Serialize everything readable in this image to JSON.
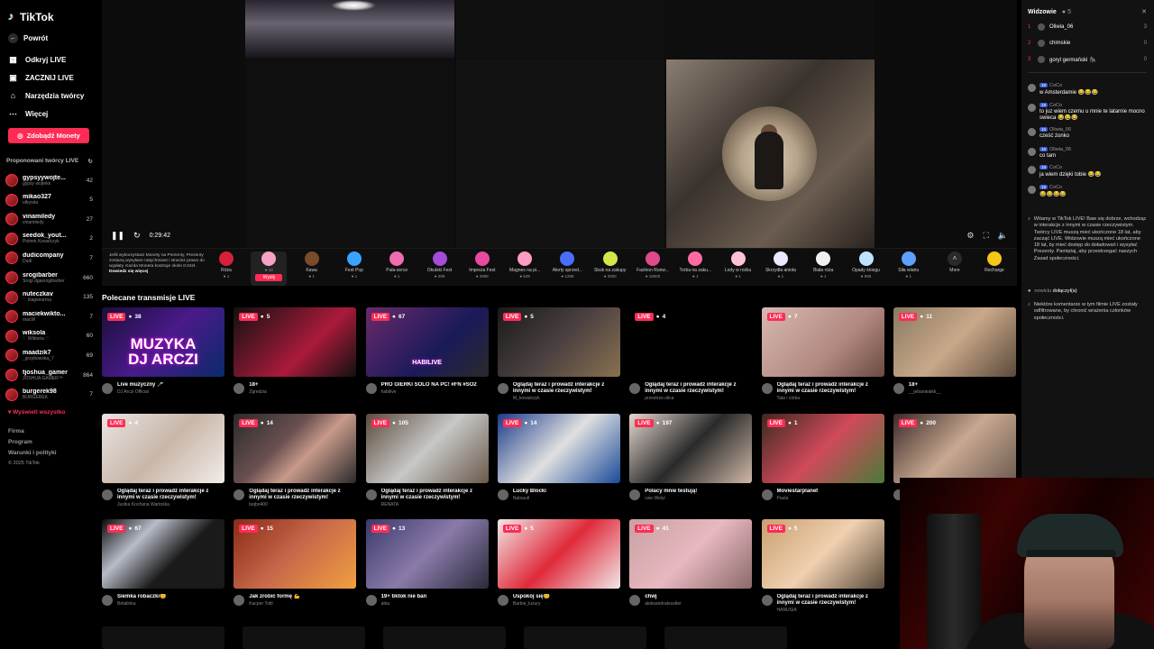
{
  "app": {
    "logo": "TikTok"
  },
  "sidebar": {
    "back": "Powrót",
    "nav": [
      {
        "label": "Odkryj LIVE",
        "icon": "tv-icon"
      },
      {
        "label": "ZACZNIJ LIVE",
        "icon": "live-icon"
      },
      {
        "label": "Narzędzia twórcy",
        "icon": "lightbulb-icon"
      },
      {
        "label": "Więcej",
        "icon": "more-icon"
      }
    ],
    "coins_button": "Zdobądź Monety",
    "suggested_title": "Proponowani twórcy LIVE",
    "creators": [
      {
        "name": "gypsyywojte...",
        "handle": "gypsy wojtekk",
        "count": "42"
      },
      {
        "name": "mikao327",
        "handle": "olkyoda",
        "count": "5"
      },
      {
        "name": "vinamiledy",
        "handle": "vinamiledy",
        "count": "27"
      },
      {
        "name": "seedok_yout...",
        "handle": "Piotrek Kowalczyk",
        "count": "2"
      },
      {
        "name": "dudicompany",
        "handle": "Dudi",
        "count": "7"
      },
      {
        "name": "srogibarber",
        "handle": "Srogi dgasrogibarber",
        "count": "660"
      },
      {
        "name": "nuteczkav",
        "handle": "♡ klagveurrna",
        "count": "135"
      },
      {
        "name": "maciekwikto...",
        "handle": "macW",
        "count": "7"
      },
      {
        "name": "wiksola",
        "handle": "♡ Wiktoria ♡",
        "count": "60"
      },
      {
        "name": "maadzik7",
        "handle": "_grzybowska_7",
        "count": "69"
      },
      {
        "name": "tjoshua_gamer",
        "handle": "JOSHUA GAMER™",
        "count": "864"
      },
      {
        "name": "burgerek98",
        "handle": "BURGEREK",
        "count": "7"
      }
    ],
    "show_all": "Wyświetl wszystko",
    "footer": [
      "Firma",
      "Program",
      "Warunki i polityki"
    ],
    "copyright": "© 2025 TikTok"
  },
  "player": {
    "time": "0:29:42"
  },
  "gifts": {
    "info": "Jeśli wykorzystasz Monety na Prezenty, Prezenty zostaną wysyłane natychmiast i stracisz prawo do wypłaty. Każda Moneta kosztuje około 0.04zł.",
    "info_link": "Dowiedz się więcej",
    "send_label": "Wyślij",
    "items": [
      {
        "name": "Róża",
        "price": "1",
        "color": "#d6203a"
      },
      {
        "name": "",
        "price": "10",
        "color": "#f7a1c4",
        "selected": true
      },
      {
        "name": "Kawa",
        "price": "1",
        "color": "#7b4a2a"
      },
      {
        "name": "Fest Pop",
        "price": "1",
        "color": "#3aa3ff"
      },
      {
        "name": "Puła-serce",
        "price": "1",
        "color": "#f06bb0"
      },
      {
        "name": "Okulski Fest",
        "price": "299",
        "color": "#a44bd9"
      },
      {
        "name": "Impreza Fest",
        "price": "2999",
        "color": "#e84aa0"
      },
      {
        "name": "Magnes na pi...",
        "price": "549",
        "color": "#ff9cc4"
      },
      {
        "name": "Alerty sprzed...",
        "price": "1299",
        "color": "#4a6cff"
      },
      {
        "name": "Skok na zakupy",
        "price": "3000",
        "color": "#d3e54a"
      },
      {
        "name": "Fashion Runw...",
        "price": "19000",
        "color": "#e04a8a"
      },
      {
        "name": "Torba na zaku...",
        "price": "1",
        "color": "#ff6aa5"
      },
      {
        "name": "Lody w rożku",
        "price": "1",
        "color": "#ffc2d4"
      },
      {
        "name": "Skrzydła anioła",
        "price": "1",
        "color": "#e8e8ff"
      },
      {
        "name": "Biała róża",
        "price": "1",
        "color": "#f0f0f0"
      },
      {
        "name": "Opady śniegu",
        "price": "999",
        "color": "#bfe3ff"
      },
      {
        "name": "Siła wiatru",
        "price": "1",
        "color": "#5ea0ff"
      }
    ],
    "more": "More",
    "recharge": "Recharge"
  },
  "recommended": {
    "title": "Polecane transmisje LIVE",
    "live_label": "LIVE",
    "tiles": [
      {
        "viewers": "38",
        "title": "Live muzyczny 🎤",
        "user": "DJ Arczi Official",
        "bg": "linear-gradient(135deg,#1a0f3a,#4a1a8a 50%,#0a2a6a)",
        "overlay": "MUZYKA\nDJ ARCZI"
      },
      {
        "viewers": "5",
        "title": "18+",
        "user": "Zgredzia",
        "bg": "linear-gradient(135deg,#111,#aa1a3a 60%,#111)"
      },
      {
        "viewers": "67",
        "title": "PRO GIERKI SOLO NA PC! #FN #SO2",
        "user": "habilive",
        "bg": "linear-gradient(135deg,#6a2a6a,#1a1a5a 60%,#2a2a2a)",
        "overlay": "HABILIVE"
      },
      {
        "viewers": "5",
        "title": "Oglądaj teraz i prowadź interakcje z innymi w czasie rzeczywistym!",
        "user": "M_kowalczyk",
        "bg": "linear-gradient(135deg,#1a1a1a,#4a4040 50%,#8a7050)"
      },
      {
        "viewers": "4",
        "title": "Oglądaj teraz i prowadź interakcje z innymi w czasie rzeczywistym!",
        "user": "przestrze.olica",
        "bg": "#000"
      },
      {
        "viewers": "7",
        "title": "Oglądaj teraz i prowadź interakcje z innymi w czasie rzeczywistym!",
        "user": "Tata i córka",
        "bg": "linear-gradient(135deg,#d8b8b0,#b08880 60%,#6a4a40)"
      },
      {
        "viewers": "11",
        "title": "18+",
        "user": "__jebanieaikk__",
        "bg": "linear-gradient(135deg,#8a7a60,#c9a88a 50%,#5a4a3a)"
      },
      {
        "viewers": "4",
        "title": "Oglądaj teraz i prowadź interakcje z innymi w czasie rzeczywistym!",
        "user": "Justka Kochana Wartośka",
        "bg": "linear-gradient(135deg,#e8e4e2,#c9b6a8 50%,#f0ece8)"
      },
      {
        "viewers": "14",
        "title": "Oglądaj teraz i prowadź interakcje z innymi w czasie rzeczywistym!",
        "user": "bejbo400",
        "bg": "linear-gradient(135deg,#2a2a2a,#6a5050 40%,#c89a8a 60%,#2a2a2a)"
      },
      {
        "viewers": "105",
        "title": "Oglądaj teraz i prowadź interakcje z innymi w czasie rzeczywistym!",
        "user": "RENATA",
        "bg": "linear-gradient(135deg,#5a4a3a,#c8c8c8 50%,#6a5a4a)"
      },
      {
        "viewers": "14",
        "title": "Lucky Blocki",
        "user": "Natsaull",
        "bg": "linear-gradient(135deg,#1a3a8a,#e0e0e0 50%,#1a4a9a)"
      },
      {
        "viewers": "197",
        "title": "Polacy mnie testują!",
        "user": "cwe.Weiyi",
        "bg": "linear-gradient(135deg,#e6d8d0,#2a2a2a 50%,#d0b8a8)"
      },
      {
        "viewers": "1",
        "title": "Moviestarplanet",
        "user": "Paula",
        "bg": "linear-gradient(135deg,#3a2a20,#d04a5a 50%,#4a7a3a)"
      },
      {
        "viewers": "200",
        "title": "",
        "user": "",
        "bg": "linear-gradient(135deg,#3a2a2a,#c8a890 50%,#6a5a50)"
      },
      {
        "viewers": "67",
        "title": "Siemka robaczki😊",
        "user": "Betalinka",
        "bg": "linear-gradient(135deg,#0a0a0a,#b8bcc8 30%,#1a1a1a 60%)"
      },
      {
        "viewers": "15",
        "title": "Jak zrobić formę 💪",
        "user": "Kacper Tottl",
        "bg": "linear-gradient(135deg,#8a2a1a,#c86a4a 50%,#f0a040)"
      },
      {
        "viewers": "13",
        "title": "19+ tiktok nie ban",
        "user": "atka",
        "bg": "linear-gradient(135deg,#3a3a6a,#8a7aaa 50%,#2a2a3a)"
      },
      {
        "viewers": "5",
        "title": "Uspokój się😊",
        "user": "Barbie_luxury",
        "bg": "linear-gradient(135deg,#f0e8e8,#e02a3a 50%,#f0e8e8)"
      },
      {
        "viewers": "41",
        "title": "chwj",
        "user": "aleksandratesstler",
        "bg": "linear-gradient(135deg,#c8a0a0,#e8b8c0 50%,#8a6a6a)"
      },
      {
        "viewers": "5",
        "title": "Oglądaj teraz i prowadź interakcje z innymi w czasie rzeczywistym!",
        "user": "HANUSIA",
        "bg": "linear-gradient(135deg,#c8a070,#f0d0b0 50%,#5a4a3a)"
      }
    ]
  },
  "chat": {
    "viewers_title": "Widzowie",
    "viewers_count": "5",
    "viewers": [
      {
        "rank": "1",
        "name": "Oliwia_06",
        "score": "3"
      },
      {
        "rank": "2",
        "name": "chimskie",
        "score": "0"
      },
      {
        "rank": "3",
        "name": "goryl germański 🦍",
        "score": "0"
      }
    ],
    "messages": [
      {
        "level": "19",
        "name": "CoCo",
        "text": "w Amsterdamie 😂😂😂"
      },
      {
        "level": "19",
        "name": "CoCo",
        "text": "to juz wiem czemu u mnie te latarnie mocno swieca 😂😂😂"
      },
      {
        "level": "16",
        "name": "Oliwia_06",
        "text": "cześć żonko"
      },
      {
        "level": "16",
        "name": "Oliwia_06",
        "text": "co tam"
      },
      {
        "level": "19",
        "name": "CoCo",
        "text": "ja wiem dzięki tobie 😂😂"
      },
      {
        "level": "19",
        "name": "CoCo",
        "text": "😂😂😂😂"
      }
    ],
    "system_welcome": "Witamy w TikTok LIVE! Baw się dobrze, wchodząc w interakcje z innymi w czasie rzeczywistym. Twórcy LIVE muszą mieć ukończone 18 lat, aby zacząć LIVE. Widzowie muszą mieć ukończone 18 lat, by mieć dostęp do doładowań i wysyłać Prezenty. Pamiętaj, aby przestrzegać naszych Zasad społeczności.",
    "join_user": "nowiclu",
    "join_text": "dołączył(a)",
    "system_filter": "Niektóre komentarze w tym filmie LIVE zostały odfiltrowane, by chronić wrażenia członków społeczności."
  }
}
